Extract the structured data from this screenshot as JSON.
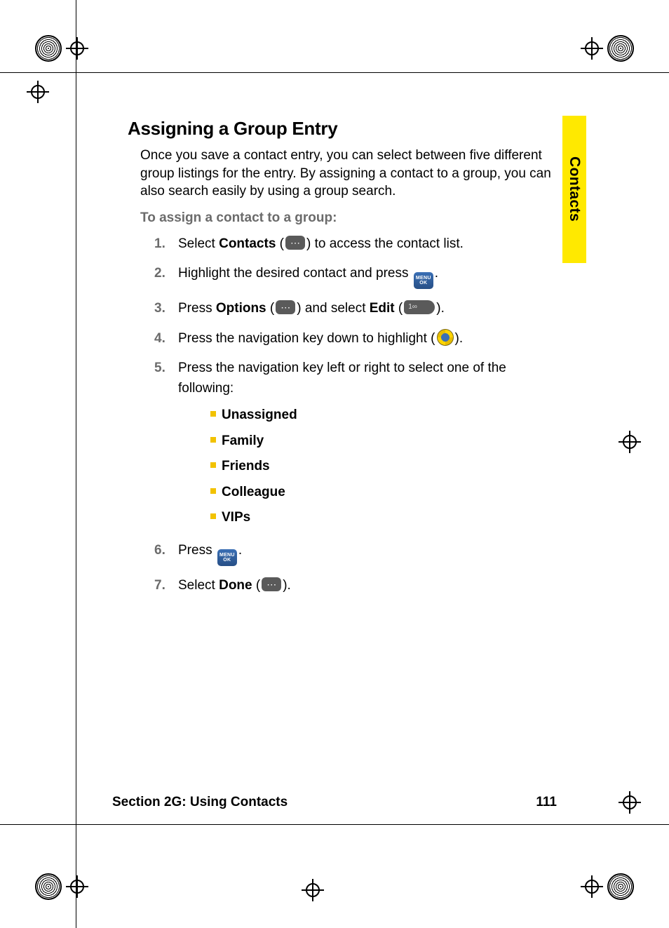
{
  "sidebar": {
    "tab_label": "Contacts"
  },
  "heading": "Assigning a Group Entry",
  "intro": "Once you save a contact entry, you can select between five different group listings for the entry. By assigning a contact to a group, you can also search easily by using a group search.",
  "subhead": "To assign a contact to a group:",
  "steps": {
    "s1_a": "Select ",
    "s1_bold": "Contacts",
    "s1_b": " (",
    "s1_c": ") to access the contact list.",
    "s2_a": "Highlight the desired contact and press ",
    "s2_b": ".",
    "s3_a": "Press ",
    "s3_bold1": "Options",
    "s3_b": " (",
    "s3_c": ") and select ",
    "s3_bold2": "Edit",
    "s3_d": " (",
    "s3_e": ").",
    "s4_a": "Press the navigation key down to highlight (",
    "s4_b": ").",
    "s5_a": "Press the navigation key left or right to select one of the following:",
    "s6_a": "Press ",
    "s6_b": ".",
    "s7_a": "Select ",
    "s7_bold": "Done",
    "s7_b": " (",
    "s7_c": ")."
  },
  "groups": [
    "Unassigned",
    "Family",
    "Friends",
    "Colleague",
    "VIPs"
  ],
  "icon_labels": {
    "menu": "MENU",
    "ok": "OK"
  },
  "footer": {
    "section": "Section 2G: Using Contacts",
    "page": "111"
  }
}
